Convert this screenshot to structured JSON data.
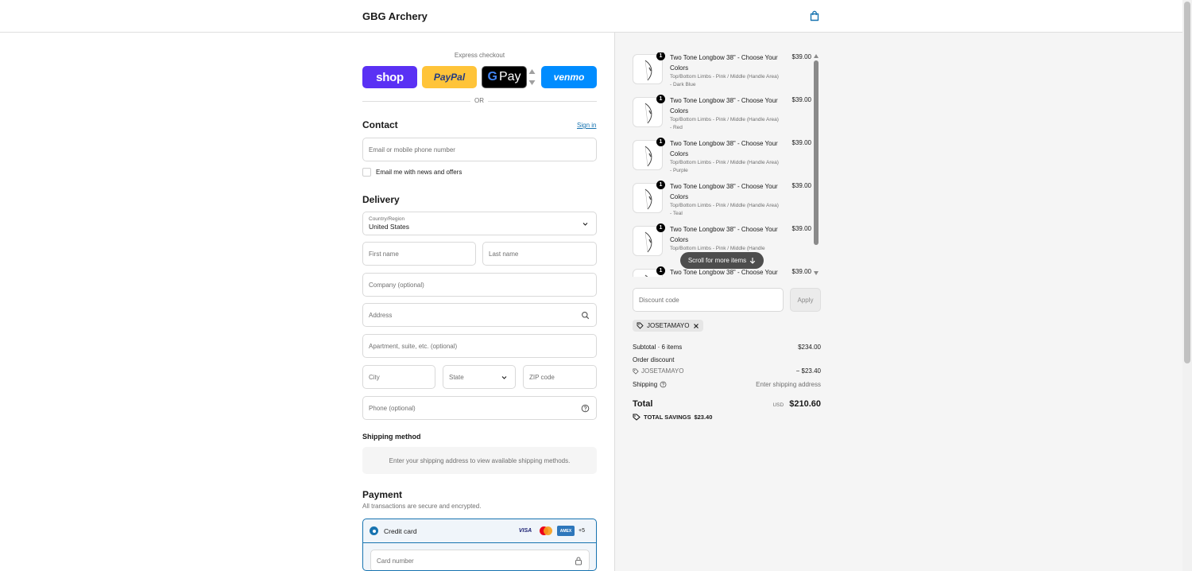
{
  "header": {
    "store_name": "GBG Archery",
    "cart_icon": "shopping-bag-icon"
  },
  "express": {
    "title": "Express checkout",
    "buttons": {
      "shop": "shop",
      "paypal": "PayPal",
      "gpay": "Pay",
      "venmo": "venmo"
    },
    "or": "OR"
  },
  "contact": {
    "title": "Contact",
    "sign_in": "Sign in",
    "email_placeholder": "Email or mobile phone number",
    "news_label": "Email me with news and offers"
  },
  "delivery": {
    "title": "Delivery",
    "country_label": "Country/Region",
    "country_value": "United States",
    "first_name": "First name",
    "last_name": "Last name",
    "company": "Company (optional)",
    "address": "Address",
    "apartment": "Apartment, suite, etc. (optional)",
    "city": "City",
    "state": "State",
    "zip": "ZIP code",
    "phone": "Phone (optional)"
  },
  "shipping": {
    "title": "Shipping method",
    "message": "Enter your shipping address to view available shipping methods."
  },
  "payment": {
    "title": "Payment",
    "subtitle": "All transactions are secure and encrypted.",
    "method": "Credit card",
    "more_cards": "+5",
    "card_number": "Card number",
    "card_logos": [
      "VISA",
      "MC",
      "AMEX"
    ]
  },
  "summary": {
    "items": [
      {
        "qty": "1",
        "title": "Two Tone Longbow 38\" - Choose Your Colors",
        "variant": "Top/Bottom Limbs - Pink / Middle (Handle Area) - Dark Blue",
        "price": "$39.00"
      },
      {
        "qty": "1",
        "title": "Two Tone Longbow 38\" - Choose Your Colors",
        "variant": "Top/Bottom Limbs - Pink / Middle (Handle Area) - Red",
        "price": "$39.00"
      },
      {
        "qty": "1",
        "title": "Two Tone Longbow 38\" - Choose Your Colors",
        "variant": "Top/Bottom Limbs - Pink / Middle (Handle Area) - Purple",
        "price": "$39.00"
      },
      {
        "qty": "1",
        "title": "Two Tone Longbow 38\" - Choose Your Colors",
        "variant": "Top/Bottom Limbs - Pink / Middle (Handle Area) - Teal",
        "price": "$39.00"
      },
      {
        "qty": "1",
        "title": "Two Tone Longbow 38\" - Choose Your Colors",
        "variant": "Top/Bottom Limbs - Pink / Middle (Handle",
        "price": "$39.00"
      },
      {
        "qty": "1",
        "title": "Two Tone Longbow 38\" - Choose Your",
        "variant": "",
        "price": "$39.00"
      }
    ],
    "scroll_hint": "Scroll for more items",
    "discount_placeholder": "Discount code",
    "apply": "Apply",
    "applied_code": "JOSETAMAYO",
    "subtotal_label": "Subtotal · 6 items",
    "subtotal_value": "$234.00",
    "order_discount_label": "Order discount",
    "order_discount_code": "JOSETAMAYO",
    "order_discount_value": "− $23.40",
    "shipping_label": "Shipping",
    "shipping_value": "Enter shipping address",
    "total_label": "Total",
    "currency": "USD",
    "total_value": "$210.60",
    "savings_label": "TOTAL SAVINGS",
    "savings_value": "$23.40"
  },
  "colors": {
    "accent": "#1773b0",
    "shop": "#5a31f4",
    "paypal": "#ffc439",
    "venmo": "#008cff"
  }
}
